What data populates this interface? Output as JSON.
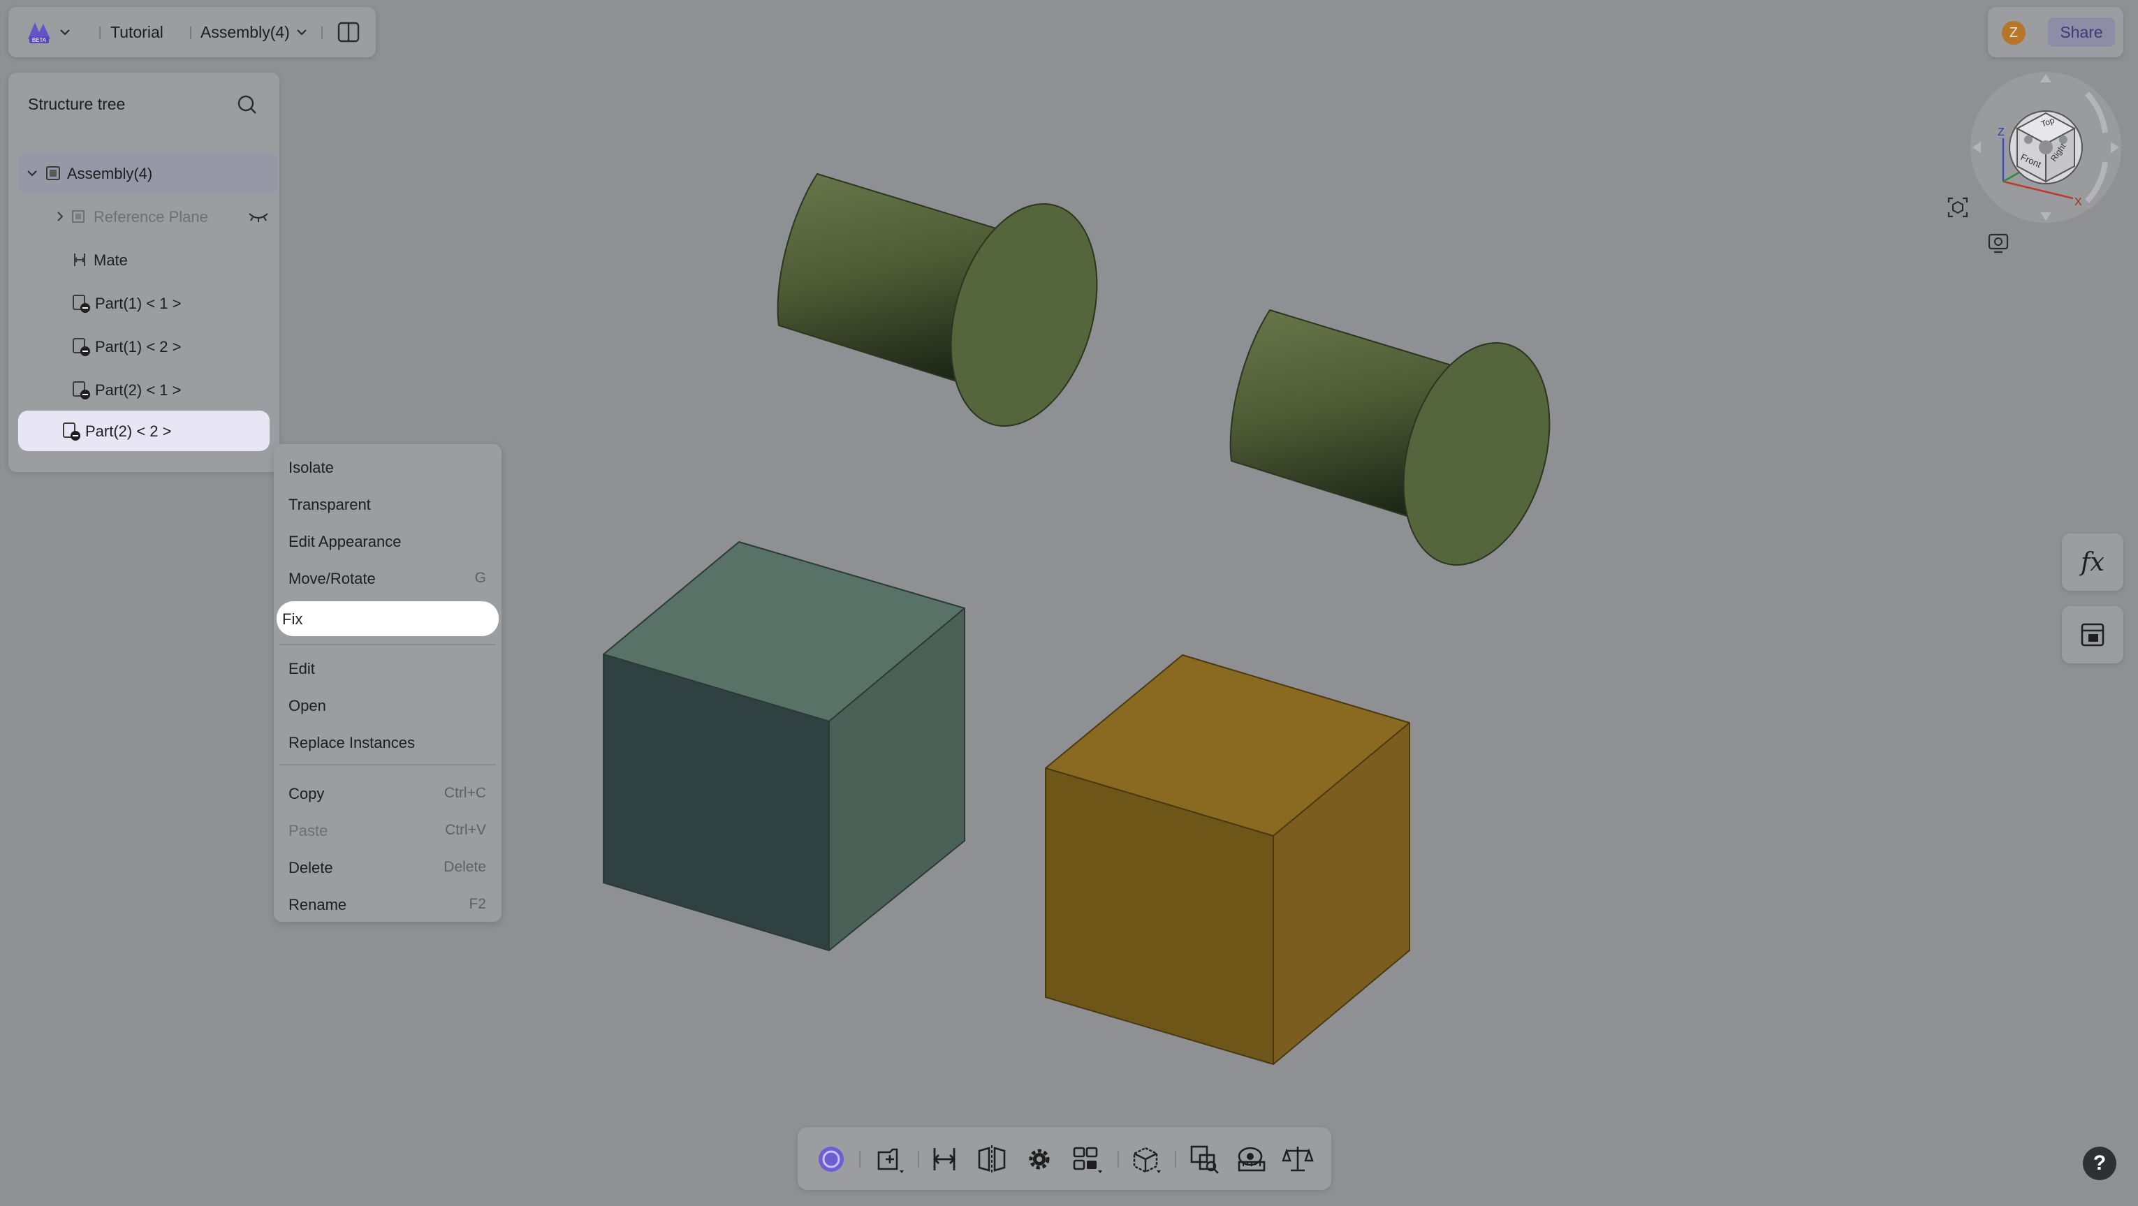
{
  "topbar": {
    "logo_icon": "app-logo-icon",
    "breadcrumb_project": "Tutorial",
    "breadcrumb_document": "Assembly(4)",
    "panel_toggle_icon": "panel-toggle-icon"
  },
  "user": {
    "avatar_initial": "Z",
    "share_label": "Share"
  },
  "tree": {
    "title": "Structure tree",
    "items": [
      {
        "label": "Assembly(4)",
        "icon": "assembly-icon"
      },
      {
        "label": "Reference Plane",
        "icon": "reference-plane-icon"
      },
      {
        "label": "Mate",
        "icon": "mate-icon"
      },
      {
        "label": "Part(1) < 1 >",
        "icon": "part-instance-icon"
      },
      {
        "label": "Part(1) < 2 >",
        "icon": "part-instance-icon"
      },
      {
        "label": "Part(2) < 1 >",
        "icon": "part-instance-icon"
      },
      {
        "label": "Part(2) < 2 >",
        "icon": "part-instance-icon"
      }
    ]
  },
  "context_menu": {
    "items": [
      {
        "label": "Isolate",
        "shortcut": ""
      },
      {
        "label": "Transparent",
        "shortcut": ""
      },
      {
        "label": "Edit Appearance",
        "shortcut": ""
      },
      {
        "label": "Move/Rotate",
        "shortcut": "G"
      },
      {
        "label": "Fix",
        "shortcut": ""
      },
      {
        "label": "Edit",
        "shortcut": ""
      },
      {
        "label": "Open",
        "shortcut": ""
      },
      {
        "label": "Replace Instances",
        "shortcut": ""
      },
      {
        "label": "Copy",
        "shortcut": "Ctrl+C"
      },
      {
        "label": "Paste",
        "shortcut": "Ctrl+V"
      },
      {
        "label": "Delete",
        "shortcut": "Delete"
      },
      {
        "label": "Rename",
        "shortcut": "F2"
      }
    ]
  },
  "viewcube": {
    "top": "Top",
    "front": "Front",
    "right": "Right",
    "axis_z": "Z",
    "axis_x": "X"
  },
  "right_tools": {
    "formula_label": "fx",
    "variables_icon": "variables-table-icon"
  },
  "toolbar": {
    "icons": [
      "rotate-mode-icon",
      "insert-part-icon",
      "mate-icon",
      "mirror-icon",
      "settings-gear-icon",
      "pattern-icon",
      "explode-view-icon",
      "interference-check-icon",
      "measure-icon",
      "mass-properties-icon"
    ]
  },
  "help_label": "?",
  "colors": {
    "cylinder": "#56663c",
    "cube_teal": "#4d6760",
    "cube_orange": "#8a6a20",
    "accent": "#6b5fd1"
  }
}
